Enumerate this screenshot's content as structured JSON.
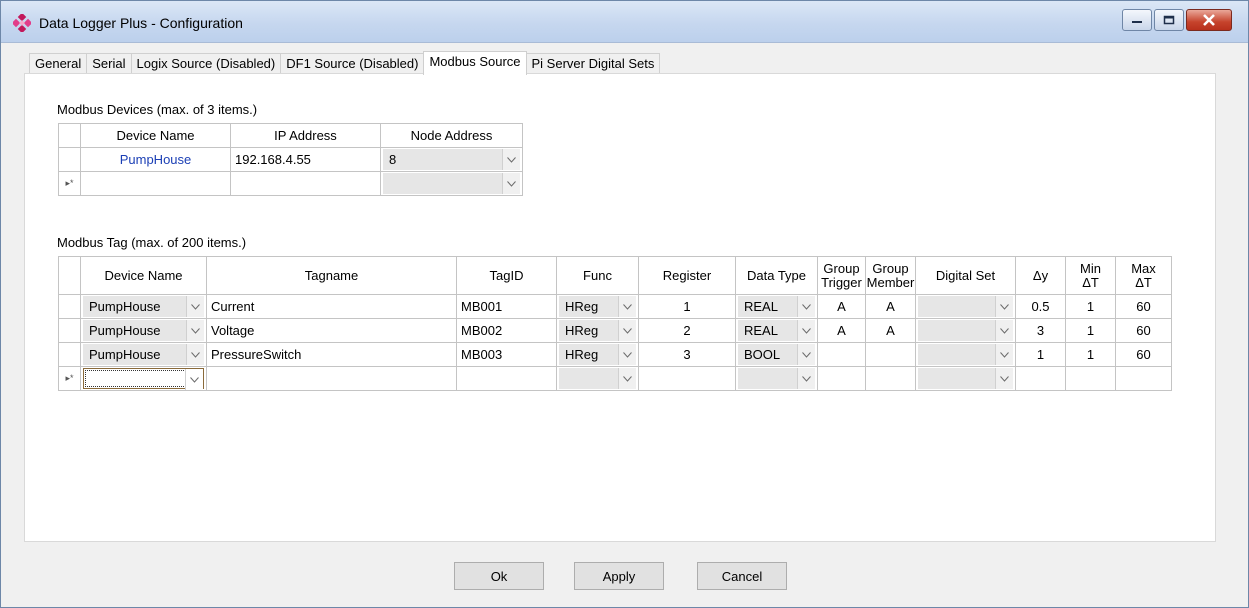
{
  "window": {
    "title": "Data Logger Plus - Configuration"
  },
  "tabs": [
    {
      "label": "General"
    },
    {
      "label": "Serial"
    },
    {
      "label": "Logix Source (Disabled)"
    },
    {
      "label": "DF1 Source (Disabled)"
    },
    {
      "label": "Modbus Source",
      "active": true
    },
    {
      "label": "Pi Server Digital Sets"
    }
  ],
  "devices": {
    "group_label": "Modbus Devices (max. of 3 items.)",
    "columns": [
      "Device Name",
      "IP Address",
      "Node Address"
    ],
    "rows": [
      {
        "device_name": "PumpHouse",
        "ip_address": "192.168.4.55",
        "node_address": "8"
      }
    ],
    "new_row_marker": "▸*"
  },
  "tags": {
    "group_label": "Modbus Tag (max. of 200 items.)",
    "columns": {
      "device_name": "Device Name",
      "tagname": "Tagname",
      "tagid": "TagID",
      "func": "Func",
      "register": "Register",
      "data_type": "Data Type",
      "group_trigger_1": "Group",
      "group_trigger_2": "Trigger",
      "group_member_1": "Group",
      "group_member_2": "Member",
      "digital_set": "Digital Set",
      "delta_y": "Δy",
      "min_dt_1": "Min",
      "min_dt_2": "ΔT",
      "max_dt_1": "Max",
      "max_dt_2": "ΔT"
    },
    "rows": [
      {
        "device_name": "PumpHouse",
        "tagname": "Current",
        "tagid": "MB001",
        "func": "HReg",
        "register": "1",
        "data_type": "REAL",
        "group_trigger": "A",
        "group_member": "A",
        "digital_set": "",
        "delta_y": "0.5",
        "min_dt": "1",
        "max_dt": "60"
      },
      {
        "device_name": "PumpHouse",
        "tagname": "Voltage",
        "tagid": "MB002",
        "func": "HReg",
        "register": "2",
        "data_type": "REAL",
        "group_trigger": "A",
        "group_member": "A",
        "digital_set": "",
        "delta_y": "3",
        "min_dt": "1",
        "max_dt": "60"
      },
      {
        "device_name": "PumpHouse",
        "tagname": "PressureSwitch",
        "tagid": "MB003",
        "func": "HReg",
        "register": "3",
        "data_type": "BOOL",
        "group_trigger": "",
        "group_member": "",
        "digital_set": "",
        "delta_y": "1",
        "min_dt": "1",
        "max_dt": "60"
      }
    ],
    "new_row_marker": "▸*"
  },
  "buttons": {
    "ok": "Ok",
    "apply": "Apply",
    "cancel": "Cancel"
  },
  "colors": {
    "accent_link": "#1b3fb5",
    "titlebar": "#c6d7ef",
    "close_button": "#c6432c"
  }
}
